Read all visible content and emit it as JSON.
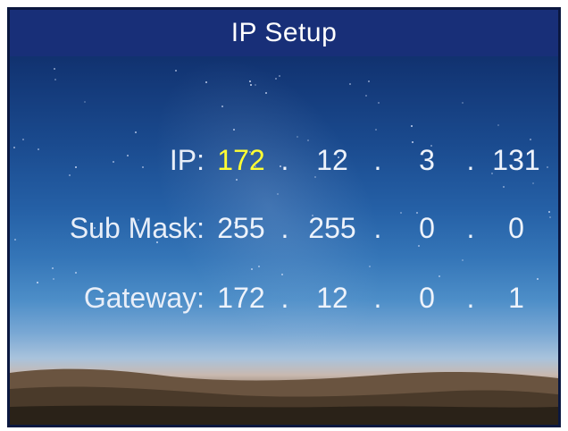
{
  "header": {
    "title": "IP Setup"
  },
  "fields": {
    "ip": {
      "label": "IP:",
      "octets": [
        "172",
        "12",
        "3",
        "131"
      ],
      "active_octet": 0
    },
    "sub_mask": {
      "label": "Sub Mask:",
      "octets": [
        "255",
        "255",
        "0",
        "0"
      ]
    },
    "gateway": {
      "label": "Gateway:",
      "octets": [
        "172",
        "12",
        "0",
        "1"
      ]
    },
    "separator": "."
  },
  "colors": {
    "title_bar": "#182f78",
    "text": "#eef3fb",
    "selected_octet": "#ffff33"
  }
}
